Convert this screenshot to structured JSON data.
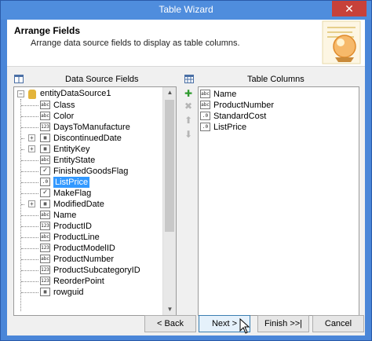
{
  "window": {
    "title": "Table Wizard",
    "close_glyph": "✕"
  },
  "header": {
    "title": "Arrange Fields",
    "subtitle": "Arrange data source fields to display as table columns."
  },
  "left_panel": {
    "heading": "Data Source Fields",
    "root": "entityDataSource1",
    "fields": [
      {
        "label": "Class",
        "icon": "abc",
        "expandable": false
      },
      {
        "label": "Color",
        "icon": "abc",
        "expandable": false
      },
      {
        "label": "DaysToManufacture",
        "icon": "123",
        "expandable": false
      },
      {
        "label": "DiscontinuedDate",
        "icon": "table",
        "expandable": true
      },
      {
        "label": "EntityKey",
        "icon": "table",
        "expandable": true
      },
      {
        "label": "EntityState",
        "icon": "abc",
        "expandable": false
      },
      {
        "label": "FinishedGoodsFlag",
        "icon": "check",
        "expandable": false
      },
      {
        "label": "ListPrice",
        "icon": ".0",
        "expandable": false,
        "selected": true
      },
      {
        "label": "MakeFlag",
        "icon": "check",
        "expandable": false
      },
      {
        "label": "ModifiedDate",
        "icon": "table",
        "expandable": true
      },
      {
        "label": "Name",
        "icon": "abc",
        "expandable": false
      },
      {
        "label": "ProductID",
        "icon": "123",
        "expandable": false
      },
      {
        "label": "ProductLine",
        "icon": "abc",
        "expandable": false
      },
      {
        "label": "ProductModelID",
        "icon": "123",
        "expandable": false
      },
      {
        "label": "ProductNumber",
        "icon": "abc",
        "expandable": false
      },
      {
        "label": "ProductSubcategoryID",
        "icon": "123",
        "expandable": false
      },
      {
        "label": "ReorderPoint",
        "icon": "123",
        "expandable": false
      },
      {
        "label": "rowguid",
        "icon": "table",
        "expandable": false
      }
    ]
  },
  "right_panel": {
    "heading": "Table Columns",
    "columns": [
      {
        "label": "Name",
        "icon": "abc"
      },
      {
        "label": "ProductNumber",
        "icon": "abc"
      },
      {
        "label": "StandardCost",
        "icon": ".0"
      },
      {
        "label": "ListPrice",
        "icon": ".0"
      }
    ]
  },
  "buttons": {
    "back": "< Back",
    "next": "Next >",
    "finish": "Finish >>|",
    "cancel": "Cancel"
  }
}
